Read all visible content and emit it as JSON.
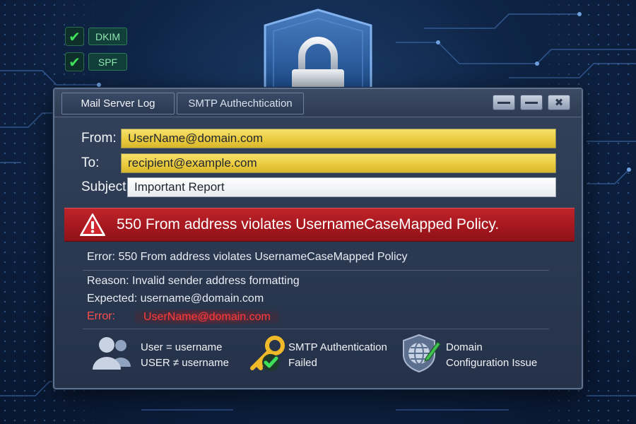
{
  "badges": [
    {
      "icon": "check-icon",
      "label": "DKIM"
    },
    {
      "icon": "check-icon",
      "label": "SPF"
    }
  ],
  "window": {
    "tabs": [
      {
        "label": "Mail Server Log"
      },
      {
        "label": "SMTP Authechtication"
      }
    ],
    "controls": {
      "minimize_icon": "minimize-icon",
      "restore_icon": "restore-icon",
      "close_label": "✖"
    }
  },
  "message": {
    "from_label": "From:",
    "from_value": "UserName@domain.com",
    "to_label": "To:",
    "to_value": "recipient@example.com",
    "subject_label": "Subject:",
    "subject_value": "Important Report"
  },
  "alert": {
    "icon": "warning-icon",
    "text": "550 From address violates UsernameCaseMapped Policy."
  },
  "details": {
    "error_line": "Error: 550 From address violates UsernameCaseMapped Policy",
    "reason_line": "Reason: Invalid sender address formatting",
    "expected_line": "Expected: username@domain.com",
    "error_label": "Error:",
    "error_value": "UserName@domain.com"
  },
  "footer": {
    "user": {
      "icon": "users-icon",
      "line1": "User = username",
      "line2": "USER ≠ username"
    },
    "smtp": {
      "icon": "key-check-icon",
      "line1": "SMTP Authentication",
      "line2": "Failed"
    },
    "domain": {
      "icon": "globe-pencil-icon",
      "line1": "Domain",
      "line2": "Configuration Issue"
    }
  },
  "colors": {
    "background": "#0f2547",
    "alert_red": "#b51e25",
    "field_yellow": "#ecd04a",
    "error_red": "#ff4d4d",
    "check_green": "#3fe05a"
  }
}
